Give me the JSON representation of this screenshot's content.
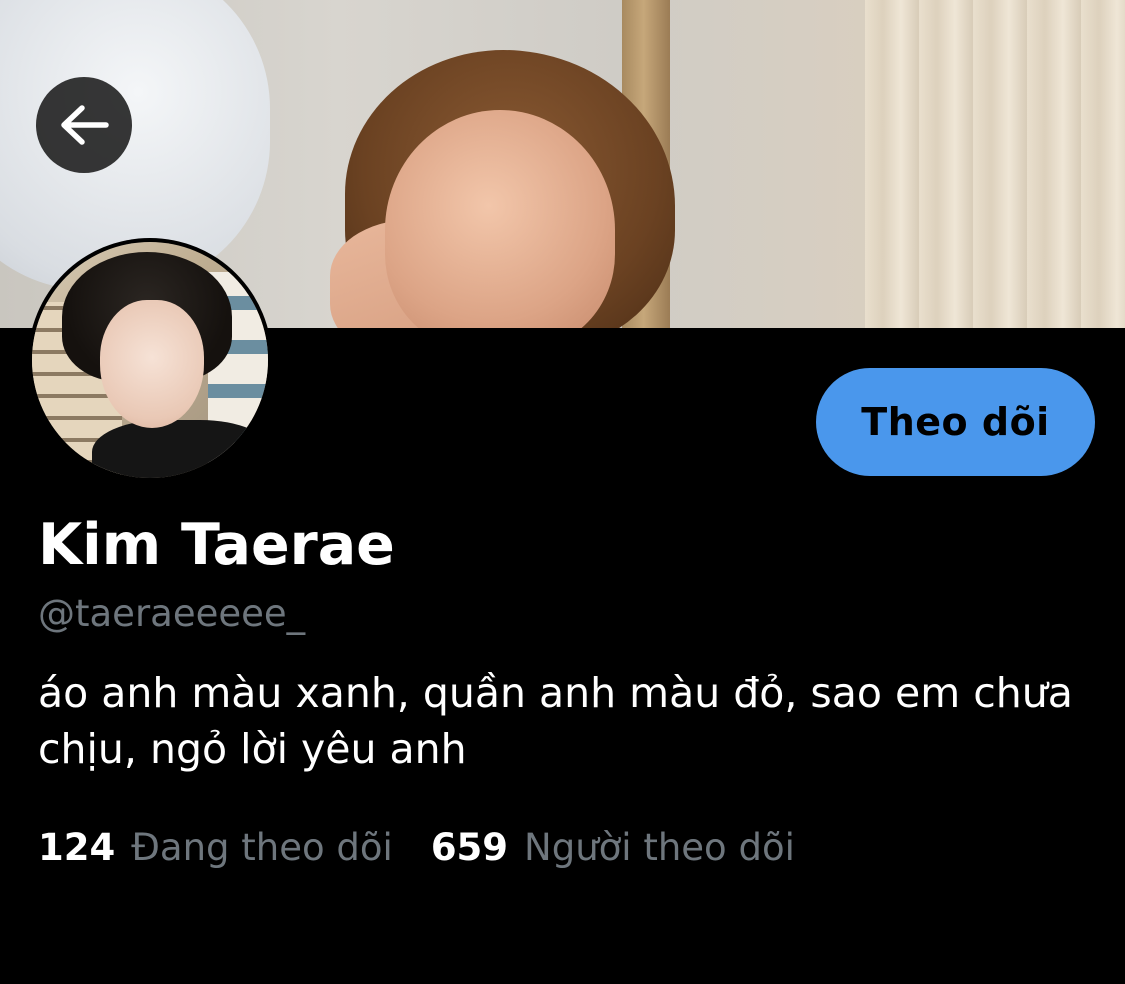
{
  "header": {
    "back_icon": "arrow-left-icon"
  },
  "profile": {
    "display_name": "Kim Taerae",
    "handle": "@taeraeeeee_",
    "bio": "áo anh màu xanh, quần anh màu đỏ, sao em chưa chịu, ngỏ lời yêu anh",
    "follow_label": "Theo dõi",
    "accent_color": "#4a97ec"
  },
  "stats": {
    "following_count": "124",
    "following_label": "Đang theo dõi",
    "followers_count": "659",
    "followers_label": "Người theo dõi"
  }
}
